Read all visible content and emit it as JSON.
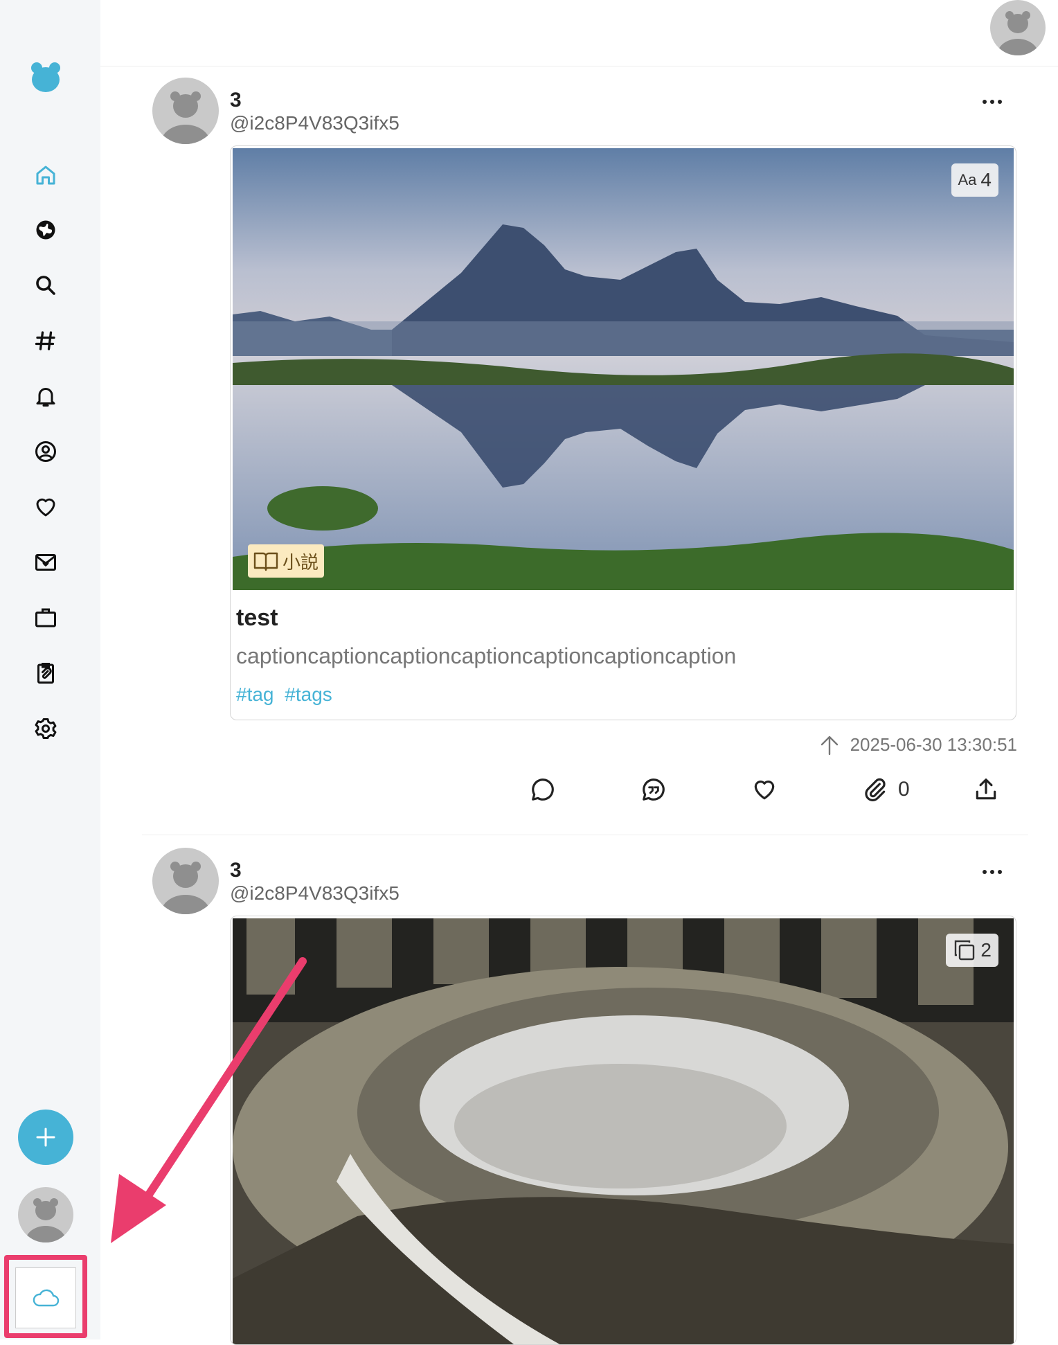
{
  "sidebar": {
    "nav": [
      {
        "name": "home",
        "icon": "home-icon",
        "active": true
      },
      {
        "name": "explore",
        "icon": "globe-icon"
      },
      {
        "name": "search",
        "icon": "search-icon"
      },
      {
        "name": "hashtags",
        "icon": "hashtag-icon"
      },
      {
        "name": "notifications",
        "icon": "bell-icon"
      },
      {
        "name": "profile",
        "icon": "user-circle-icon"
      },
      {
        "name": "likes",
        "icon": "heart-icon"
      },
      {
        "name": "messages",
        "icon": "mail-heart-icon"
      },
      {
        "name": "jobs",
        "icon": "briefcase-icon"
      },
      {
        "name": "clipboard",
        "icon": "clipboard-icon"
      },
      {
        "name": "settings",
        "icon": "gear-icon"
      }
    ],
    "compose_icon": "plus-icon",
    "cloud_icon": "cloud-icon"
  },
  "posts": [
    {
      "author": {
        "name": "3",
        "handle": "@i2c8P4V83Q3ifx5"
      },
      "badge": {
        "prefix": "Aa",
        "count": "4"
      },
      "genre_label": "小説",
      "title": "test",
      "caption": "captioncaptioncaptioncaptioncaptioncaptioncaption",
      "tags": [
        "#tag",
        "#tags"
      ],
      "timestamp": "2025-06-30 13:30:51",
      "bookmark_count": "0"
    },
    {
      "author": {
        "name": "3",
        "handle": "@i2c8P4V83Q3ifx5"
      },
      "badge": {
        "count": "2"
      }
    }
  ],
  "colors": {
    "accent": "#46b3d6",
    "annotation": "#ea3d6d",
    "sidebar_bg": "#f4f6f8"
  }
}
